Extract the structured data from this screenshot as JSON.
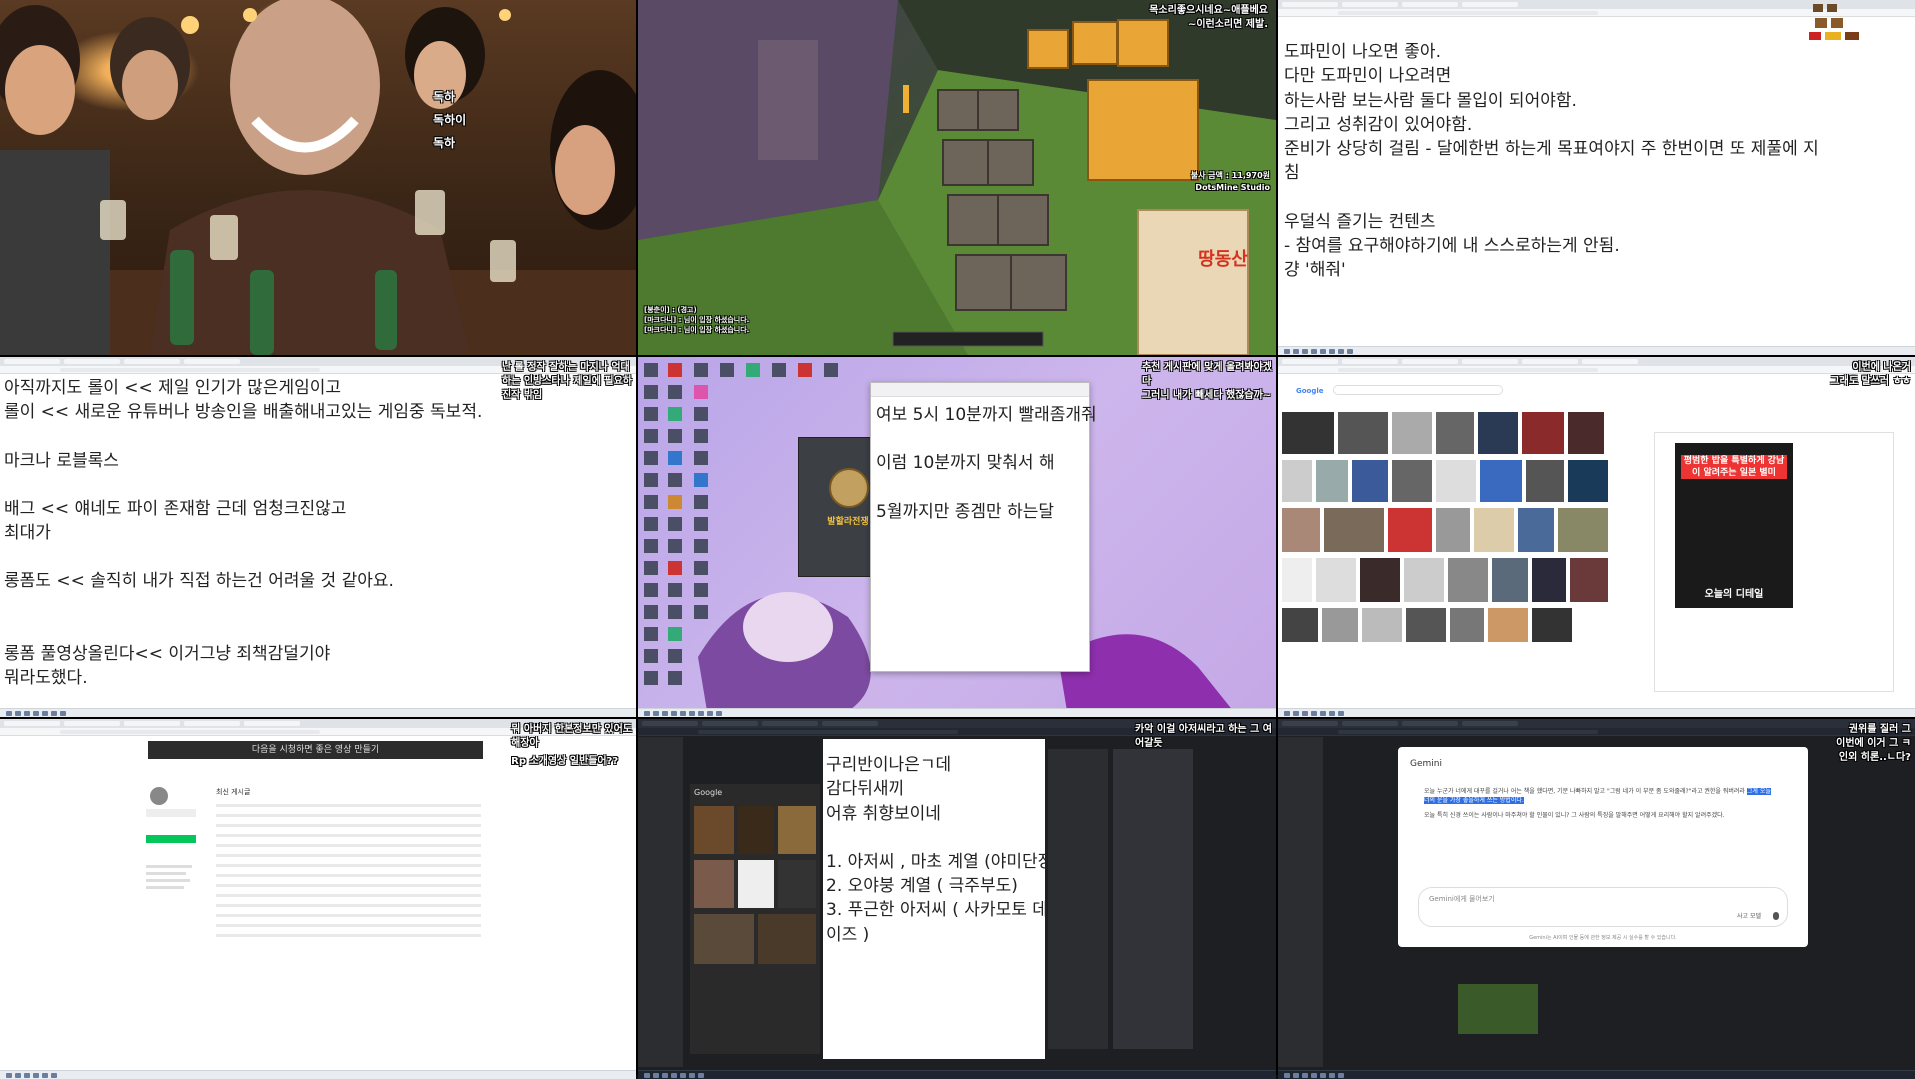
{
  "tile1": {
    "chat": [
      "독하",
      "독하이",
      "독하"
    ]
  },
  "tile2": {
    "chat_top": [
      "목소리좋으시네요~애플베요",
      "~이런소리면 제발."
    ],
    "stat": "불사 금액 : 11,970원",
    "studio": "DotsMine Studio",
    "sign": "땅동산",
    "bottom_chat": [
      "[봉춘이] : (경고)",
      "[마크다니] : 님이 입장 하셨습니다.",
      "[마크다니] : 님이 입장 하셨습니다."
    ]
  },
  "tile3": {
    "lines": [
      "도파민이 나오면 좋아.",
      "다만 도파민이 나오려면",
      "하는사람 보는사람 둘다 몰입이 되어야함.",
      "그리고 성취감이 있어야함.",
      "준비가 상당히 걸림 - 달에한번 하는게 목표여야지 주 한번이면 또 제풀에 지",
      "침",
      "",
      "우덜식 즐기는 컨텐츠",
      "- 참여를 요구해야하기에 내 스스로하는게 안됨.",
      "걍 '해줘'"
    ]
  },
  "tile4": {
    "chat": [
      "난 롤 정작 잘하는 마지나 억대",
      "하는 인방스타나 제일에 필요하",
      "진작 밖임"
    ],
    "lines": [
      "아직까지도 롤이 << 제일 인기가 많은게임이고",
      "롤이 << 새로운 유튜버나 방송인을 배출해내고있는 게임중 독보적.",
      "",
      "마크나 로블록스",
      "",
      "배그 << 얘네도 파이 존재함 근데 엄청크진않고",
      "최대가",
      "",
      "롱폼도 << 솔직히 내가 직접 하는건 어려울 것 같아요.",
      "",
      "",
      "롱폼 풀영상올린다<< 이거그냥 죄책감덜기야",
      "뭐라도했다."
    ]
  },
  "tile5": {
    "chat": [
      "추천 게시판에 맞게 올려봐야겠",
      "다",
      "그러니 내가 빼세다 했잖습까~"
    ],
    "notepad": [
      "여보 5시 10분까지 빨래좀개줘",
      "이럼 10분까지 맞춰서 해",
      "5월까지만 종겜만 하는달"
    ],
    "game_badge": "발할라전쟁"
  },
  "tile6": {
    "search_logo": "Google",
    "chat": [
      "이번에 나온거",
      "그래도 말쓰러 ㅎㅎ"
    ],
    "ad_title": "평범한 밥을 특별하게 강남이 알려주는 일본 별미",
    "ad_footer": "오늘의 디테일"
  },
  "tile7": {
    "chat": [
      "뭐 아버지 한본정보만 있어도",
      "해장아",
      "Rp 소개영상 일반들어??"
    ],
    "banner": "다음을 시청하면 좋은 영상 만들기",
    "board_title": "최신 게시글"
  },
  "tile8": {
    "logo": "Google",
    "chat_top": [
      "카악 이걸 아저씨라고 하는 그 여",
      "어갈듯"
    ],
    "lines": [
      "구리반이나은ㄱ데",
      "감다뒤새끼",
      "어휴 취향보이네",
      "",
      "1. 아저씨 , 마초 계열 (야미단장",
      "2. 오야붕 계열 ( 극주부도)",
      "3. 푸근한 아저씨 ( 사카모토 데",
      "이즈 )"
    ]
  },
  "tile9": {
    "chat": [
      "권위를 질러 그",
      "이번에 이거 그 ㅋ",
      "인외 히론..ㄴ다?"
    ],
    "app_title": "Gemini",
    "response_text": "오늘 누군가 너에게 대꾸를 걸거나 어는 책을 했다면, 기분 나빠하지 말고 \"그럼 네가 이 부분 좀 도와줄래?\"라고 권한을 줘버려라",
    "response_highlight": "그게 오늘 너의 운을 가장 좋을하게 쓰는 방법이다.",
    "response_text2": "오늘 특히 신경 쓰이는 사람이나 마주쳐야 할 인물이 있니? 그 사람의 특징을 말해주면 어떻게 요리해야 할지 알려주겠다.",
    "input_placeholder": "Gemini에게 물어보기",
    "model_label": "사고 모델",
    "footer": "Gemini는 AI이며 인물 등에 관한 정보 제공 시 실수를 할 수 있습니다."
  }
}
